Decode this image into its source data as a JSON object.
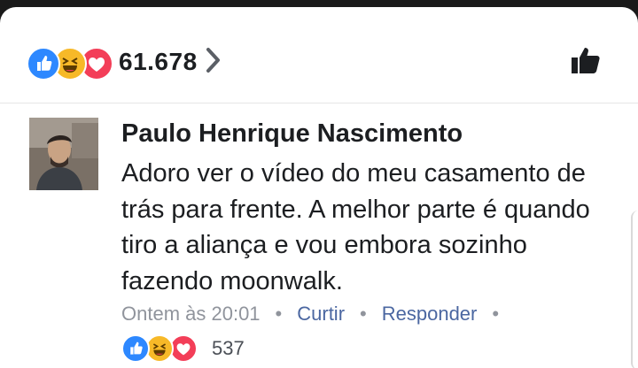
{
  "reactions_summary": {
    "icons": [
      "like-icon",
      "haha-icon",
      "love-icon"
    ],
    "count": "61.678"
  },
  "comment": {
    "author": "Paulo Henrique Nascimento",
    "text": "Adoro ver o vídeo do meu casamento de trás para frente. A melhor parte é quando tiro a aliança e vou embora sozinho fazendo moonwalk.",
    "timestamp": "Ontem às 20:01",
    "like_label": "Curtir",
    "reply_label": "Responder",
    "reactions": {
      "icons": [
        "like-icon",
        "haha-icon",
        "love-icon"
      ],
      "count": "537"
    }
  },
  "colors": {
    "like": "#2d88ff",
    "haha": "#f7b928",
    "love": "#f33e58",
    "link": "#4b67a1",
    "meta": "#90949c"
  }
}
